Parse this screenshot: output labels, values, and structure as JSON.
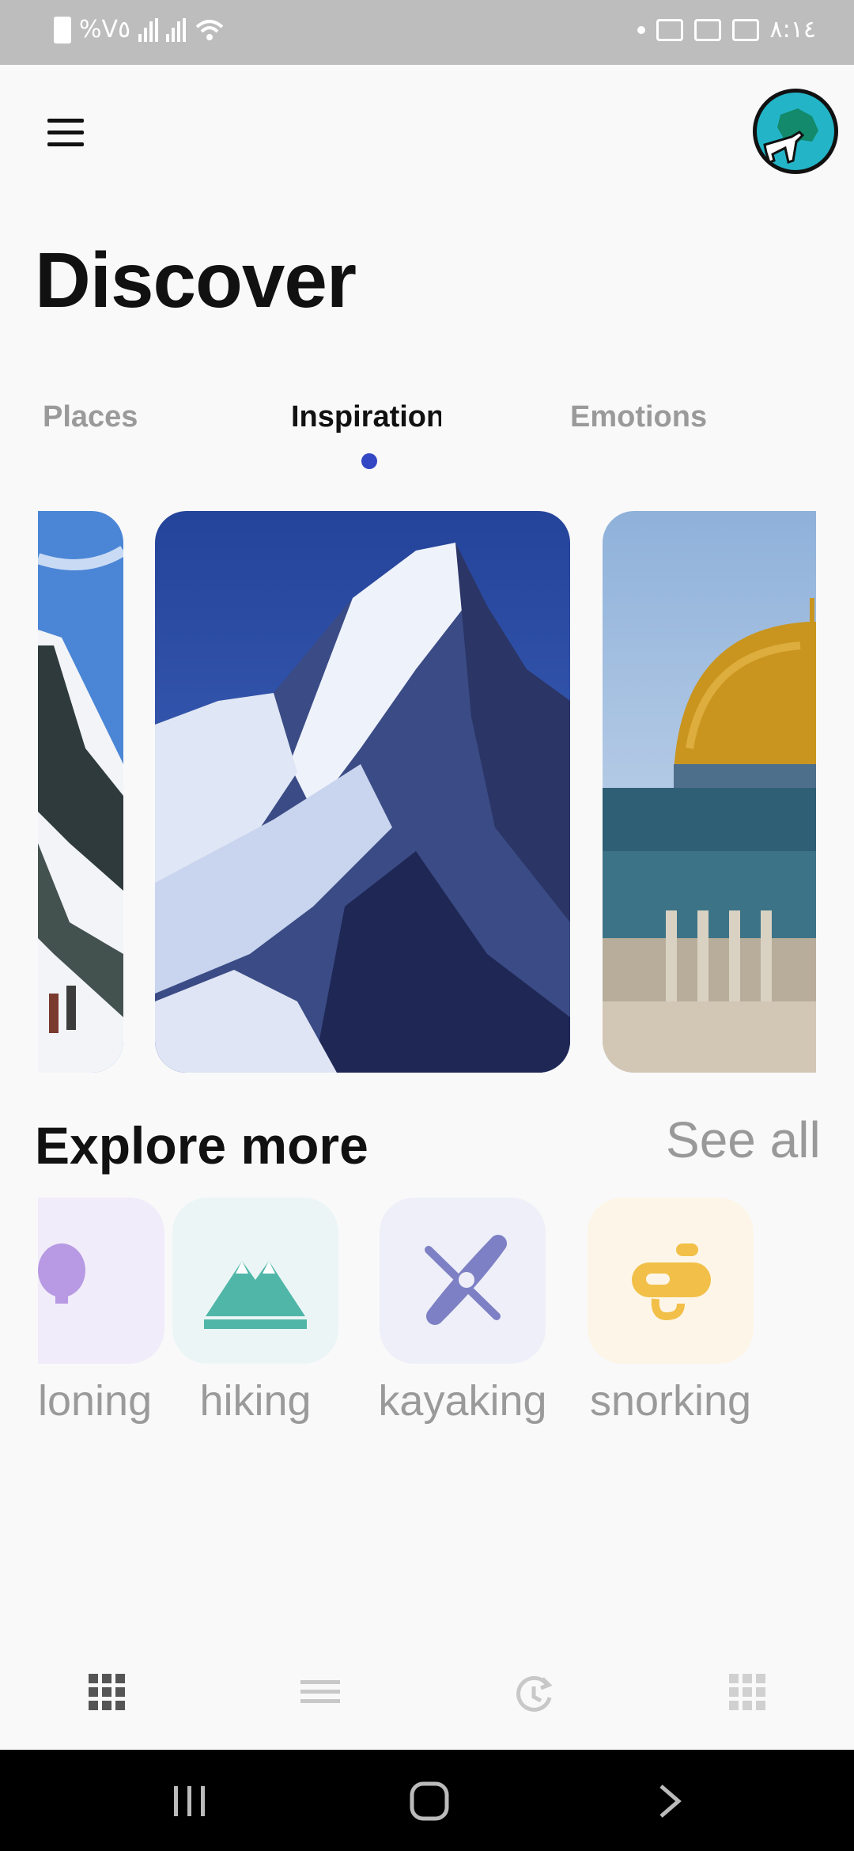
{
  "status_bar": {
    "battery_percent": "%V٥",
    "time": "٨:١٤",
    "icons": [
      "battery-charging-icon",
      "signal-icon",
      "signal-icon",
      "wifi-icon",
      "notification-dot-icon",
      "gallery-icon",
      "camera-icon",
      "image-icon"
    ]
  },
  "header": {
    "menu_icon": "hamburger-menu-icon",
    "avatar_icon": "globe-airplane-icon"
  },
  "page": {
    "title": "Discover"
  },
  "tabs": [
    {
      "label": "Places",
      "active": false
    },
    {
      "label": "Inspiration",
      "active": true
    },
    {
      "label": "Emotions",
      "active": false
    }
  ],
  "cards": [
    {
      "subject": "climbers on snowy ridge"
    },
    {
      "subject": "snow-capped mountain peak"
    },
    {
      "subject": "golden-domed mosque"
    }
  ],
  "explore": {
    "title": "Explore more",
    "see_all": "See all",
    "categories": [
      {
        "label": "loning",
        "icon": "balloon-icon",
        "tile_color": "#f1ecf9",
        "icon_color": "#b79ae3"
      },
      {
        "label": "hiking",
        "icon": "mountains-icon",
        "tile_color": "#ecf5f5",
        "icon_color": "#4fb6a8"
      },
      {
        "label": "kayaking",
        "icon": "kayak-icon",
        "tile_color": "#eeeff8",
        "icon_color": "#7d80c4"
      },
      {
        "label": "snorking",
        "icon": "snorkel-mask-icon",
        "tile_color": "#fdf6e8",
        "icon_color": "#f2c048"
      }
    ]
  },
  "bottom_nav": [
    {
      "icon": "grid-icon",
      "active": true
    },
    {
      "icon": "list-icon",
      "active": false
    },
    {
      "icon": "history-icon",
      "active": false
    },
    {
      "icon": "apps-icon",
      "active": false
    }
  ],
  "system_nav": [
    "recents-icon",
    "home-icon",
    "back-icon"
  ],
  "colors": {
    "accent": "#3346c4",
    "background": "#f9f9fa",
    "inactive_text": "#9a9a9a"
  }
}
